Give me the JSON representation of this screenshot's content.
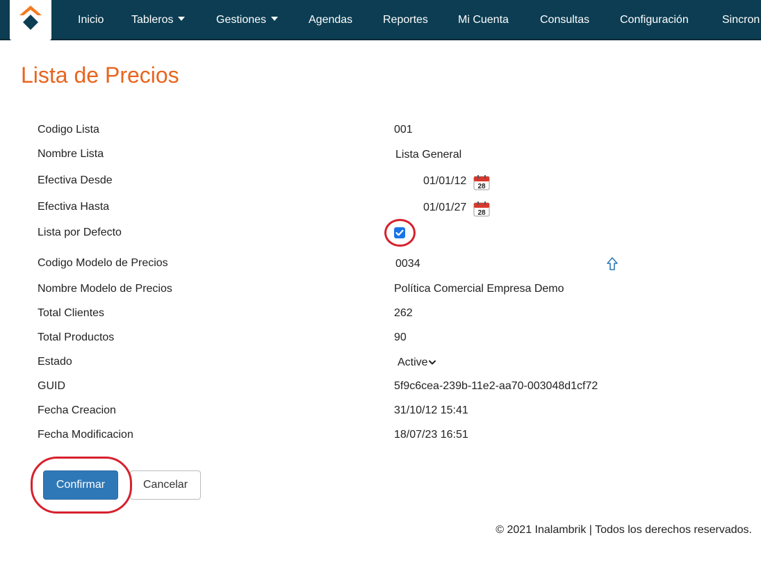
{
  "nav": {
    "items": [
      {
        "label": "Inicio"
      },
      {
        "label": "Tableros"
      },
      {
        "label": "Gestiones"
      },
      {
        "label": "Agendas"
      },
      {
        "label": "Reportes"
      },
      {
        "label": "Mi Cuenta"
      },
      {
        "label": "Consultas"
      },
      {
        "label": "Configuración"
      },
      {
        "label": "Sincron"
      }
    ]
  },
  "page": {
    "title": "Lista de Precios"
  },
  "form": {
    "codigo_lista": {
      "label": "Codigo Lista",
      "value": "001"
    },
    "nombre_lista": {
      "label": "Nombre Lista",
      "value": "Lista General"
    },
    "efectiva_desde": {
      "label": "Efectiva Desde",
      "value": "01/01/12"
    },
    "efectiva_hasta": {
      "label": "Efectiva Hasta",
      "value": "01/01/27"
    },
    "lista_defecto": {
      "label": "Lista por Defecto",
      "checked": true
    },
    "codigo_modelo": {
      "label": "Codigo Modelo de Precios",
      "value": "0034"
    },
    "nombre_modelo": {
      "label": "Nombre Modelo de Precios",
      "value": "Política Comercial Empresa Demo"
    },
    "total_clientes": {
      "label": "Total Clientes",
      "value": "262"
    },
    "total_productos": {
      "label": "Total Productos",
      "value": "90"
    },
    "estado": {
      "label": "Estado",
      "value": "Active"
    },
    "guid": {
      "label": "GUID",
      "value": "5f9c6cea-239b-11e2-aa70-003048d1cf72"
    },
    "fecha_creacion": {
      "label": "Fecha Creacion",
      "value": "31/10/12 15:41"
    },
    "fecha_modificacion": {
      "label": "Fecha Modificacion",
      "value": "18/07/23 16:51"
    },
    "calendar_day": "28"
  },
  "buttons": {
    "confirm": "Confirmar",
    "cancel": "Cancelar"
  },
  "footer": {
    "text": "© 2021 Inalambrik | Todos los derechos reservados."
  },
  "colors": {
    "navbar": "#0c3d52",
    "title": "#e8651f",
    "primary": "#2f78b7",
    "highlight": "#d7202d",
    "checkbox": "#1a73e8"
  },
  "icons": {
    "logo": "inalambrik-logo",
    "calendar": "calendar-icon",
    "up_arrow": "arrow-up-icon",
    "dropdown": "chevron-down-icon"
  }
}
